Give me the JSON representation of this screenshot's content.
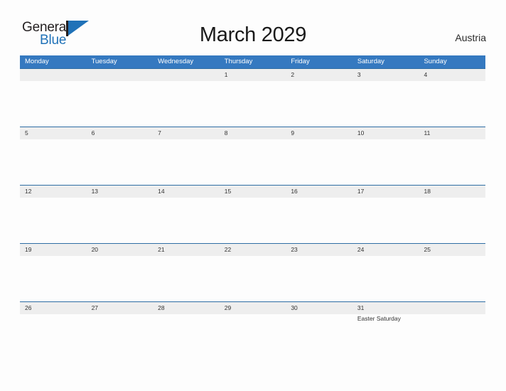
{
  "brand": {
    "name_part1": "General",
    "name_part2": "Blue",
    "flag_icon": "blue-flag-triangle",
    "accent_color": "#2072b8"
  },
  "header": {
    "title": "March 2029",
    "country": "Austria"
  },
  "theme": {
    "header_blue": "#3579c0",
    "header_border": "#2e6da4",
    "date_strip_gray": "#eeeeee",
    "page_background": "#fdfdfd",
    "text_color": "#333333"
  },
  "calendar": {
    "month": "March",
    "year": "2029",
    "weekdays": [
      "Monday",
      "Tuesday",
      "Wednesday",
      "Thursday",
      "Friday",
      "Saturday",
      "Sunday"
    ],
    "weeks": [
      {
        "days": [
          {
            "date": "",
            "events": []
          },
          {
            "date": "",
            "events": []
          },
          {
            "date": "",
            "events": []
          },
          {
            "date": "1",
            "events": []
          },
          {
            "date": "2",
            "events": []
          },
          {
            "date": "3",
            "events": []
          },
          {
            "date": "4",
            "events": []
          }
        ]
      },
      {
        "days": [
          {
            "date": "5",
            "events": []
          },
          {
            "date": "6",
            "events": []
          },
          {
            "date": "7",
            "events": []
          },
          {
            "date": "8",
            "events": []
          },
          {
            "date": "9",
            "events": []
          },
          {
            "date": "10",
            "events": []
          },
          {
            "date": "11",
            "events": []
          }
        ]
      },
      {
        "days": [
          {
            "date": "12",
            "events": []
          },
          {
            "date": "13",
            "events": []
          },
          {
            "date": "14",
            "events": []
          },
          {
            "date": "15",
            "events": []
          },
          {
            "date": "16",
            "events": []
          },
          {
            "date": "17",
            "events": []
          },
          {
            "date": "18",
            "events": []
          }
        ]
      },
      {
        "days": [
          {
            "date": "19",
            "events": []
          },
          {
            "date": "20",
            "events": []
          },
          {
            "date": "21",
            "events": []
          },
          {
            "date": "22",
            "events": []
          },
          {
            "date": "23",
            "events": []
          },
          {
            "date": "24",
            "events": []
          },
          {
            "date": "25",
            "events": []
          }
        ]
      },
      {
        "days": [
          {
            "date": "26",
            "events": []
          },
          {
            "date": "27",
            "events": []
          },
          {
            "date": "28",
            "events": []
          },
          {
            "date": "29",
            "events": []
          },
          {
            "date": "30",
            "events": []
          },
          {
            "date": "31",
            "events": [
              "Easter Saturday"
            ]
          },
          {
            "date": "",
            "events": []
          }
        ]
      }
    ]
  }
}
